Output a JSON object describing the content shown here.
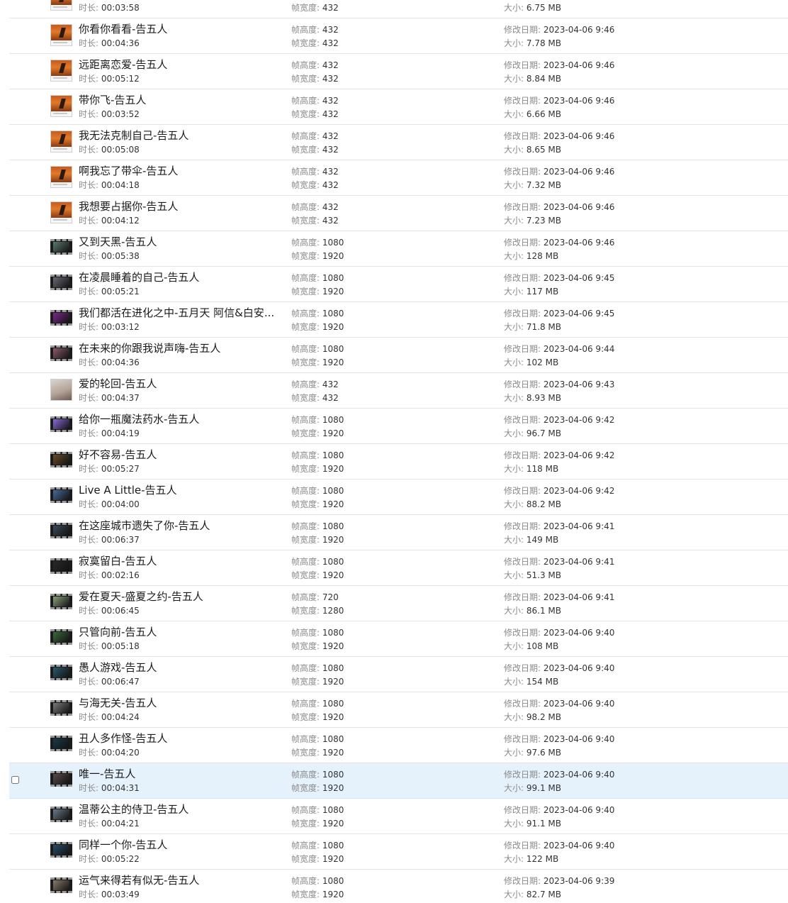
{
  "labels": {
    "duration": "时长:",
    "frame_height": "帧高度:",
    "frame_width": "帧宽度:",
    "modified": "修改日期:",
    "size": "大小:"
  },
  "items": [
    {
      "name": "",
      "duration": "00:03:58",
      "frame_height": "",
      "frame_width": "432",
      "modified": "",
      "size": "6.75 MB",
      "thumb": "music",
      "tint": "#c85a1e",
      "selected": false
    },
    {
      "name": "你看你看看-告五人",
      "duration": "00:04:36",
      "frame_height": "432",
      "frame_width": "432",
      "modified": "2023-04-06 9:46",
      "size": "7.78 MB",
      "thumb": "music",
      "tint": "#c85a1e",
      "selected": false
    },
    {
      "name": "远距离恋爱-告五人",
      "duration": "00:05:12",
      "frame_height": "432",
      "frame_width": "432",
      "modified": "2023-04-06 9:46",
      "size": "8.84 MB",
      "thumb": "music",
      "tint": "#c85a1e",
      "selected": false
    },
    {
      "name": "带你飞-告五人",
      "duration": "00:03:52",
      "frame_height": "432",
      "frame_width": "432",
      "modified": "2023-04-06 9:46",
      "size": "6.66 MB",
      "thumb": "music",
      "tint": "#c85a1e",
      "selected": false
    },
    {
      "name": "我无法克制自己-告五人",
      "duration": "00:05:08",
      "frame_height": "432",
      "frame_width": "432",
      "modified": "2023-04-06 9:46",
      "size": "8.65 MB",
      "thumb": "music",
      "tint": "#c85a1e",
      "selected": false
    },
    {
      "name": "啊我忘了带伞-告五人",
      "duration": "00:04:18",
      "frame_height": "432",
      "frame_width": "432",
      "modified": "2023-04-06 9:46",
      "size": "7.32 MB",
      "thumb": "music",
      "tint": "#c85a1e",
      "selected": false
    },
    {
      "name": "我想要占据你-告五人",
      "duration": "00:04:12",
      "frame_height": "432",
      "frame_width": "432",
      "modified": "2023-04-06 9:46",
      "size": "7.23 MB",
      "thumb": "music",
      "tint": "#c85a1e",
      "selected": false
    },
    {
      "name": "又到天黑-告五人",
      "duration": "00:05:38",
      "frame_height": "1080",
      "frame_width": "1920",
      "modified": "2023-04-06 9:46",
      "size": "128 MB",
      "thumb": "film",
      "tint": "#5a7a6e",
      "selected": false
    },
    {
      "name": "在凌晨睡着的自己-告五人",
      "duration": "00:05:21",
      "frame_height": "1080",
      "frame_width": "1920",
      "modified": "2023-04-06 9:45",
      "size": "117 MB",
      "thumb": "film",
      "tint": "#6a6a78",
      "selected": false
    },
    {
      "name": "我们都活在进化之中-五月天 阿信&白安...",
      "duration": "00:03:12",
      "frame_height": "1080",
      "frame_width": "1920",
      "modified": "2023-04-06 9:45",
      "size": "71.8 MB",
      "thumb": "film",
      "tint": "#7a2a8a",
      "selected": false
    },
    {
      "name": "在未来的你跟我说声嗨-告五人",
      "duration": "00:04:36",
      "frame_height": "1080",
      "frame_width": "1920",
      "modified": "2023-04-06 9:44",
      "size": "102 MB",
      "thumb": "film",
      "tint": "#8a5a6a",
      "selected": false
    },
    {
      "name": "爱的轮回-告五人",
      "duration": "00:04:37",
      "frame_height": "432",
      "frame_width": "432",
      "modified": "2023-04-06 9:43",
      "size": "8.93 MB",
      "thumb": "photo",
      "tint": "#b5a59a",
      "selected": false
    },
    {
      "name": "给你一瓶魔法药水-告五人",
      "duration": "00:04:19",
      "frame_height": "1080",
      "frame_width": "1920",
      "modified": "2023-04-06 9:42",
      "size": "96.7 MB",
      "thumb": "film",
      "tint": "#8a6ad8",
      "selected": false
    },
    {
      "name": "好不容易-告五人",
      "duration": "00:05:27",
      "frame_height": "1080",
      "frame_width": "1920",
      "modified": "2023-04-06 9:42",
      "size": "118 MB",
      "thumb": "film",
      "tint": "#6a4a2a",
      "selected": false
    },
    {
      "name": "Live A Little-告五人",
      "duration": "00:04:00",
      "frame_height": "1080",
      "frame_width": "1920",
      "modified": "2023-04-06 9:42",
      "size": "88.2 MB",
      "thumb": "film",
      "tint": "#4a6a9a",
      "selected": false
    },
    {
      "name": "在这座城市遗失了你-告五人",
      "duration": "00:06:37",
      "frame_height": "1080",
      "frame_width": "1920",
      "modified": "2023-04-06 9:41",
      "size": "149 MB",
      "thumb": "film",
      "tint": "#3a4a5a",
      "selected": false
    },
    {
      "name": "寂寞留白-告五人",
      "duration": "00:02:16",
      "frame_height": "1080",
      "frame_width": "1920",
      "modified": "2023-04-06 9:41",
      "size": "51.3 MB",
      "thumb": "film",
      "tint": "#2a2a2a",
      "selected": false
    },
    {
      "name": "爱在夏天-盛夏之约-告五人",
      "duration": "00:06:45",
      "frame_height": "720",
      "frame_width": "1280",
      "modified": "2023-04-06 9:41",
      "size": "86.1 MB",
      "thumb": "film",
      "tint": "#8aa07a",
      "selected": false
    },
    {
      "name": "只管向前-告五人",
      "duration": "00:05:18",
      "frame_height": "1080",
      "frame_width": "1920",
      "modified": "2023-04-06 9:40",
      "size": "108 MB",
      "thumb": "film",
      "tint": "#3a6a3a",
      "selected": false
    },
    {
      "name": "愚人游戏-告五人",
      "duration": "00:06:47",
      "frame_height": "1080",
      "frame_width": "1920",
      "modified": "2023-04-06 9:40",
      "size": "154 MB",
      "thumb": "film",
      "tint": "#2a5a6a",
      "selected": false
    },
    {
      "name": "与海无关-告五人",
      "duration": "00:04:24",
      "frame_height": "1080",
      "frame_width": "1920",
      "modified": "2023-04-06 9:40",
      "size": "98.2 MB",
      "thumb": "film",
      "tint": "#7a7a7a",
      "selected": false
    },
    {
      "name": "丑人多作怪-告五人",
      "duration": "00:04:20",
      "frame_height": "1080",
      "frame_width": "1920",
      "modified": "2023-04-06 9:40",
      "size": "97.6 MB",
      "thumb": "film",
      "tint": "#1a3a4a",
      "selected": false
    },
    {
      "name": "唯一-告五人",
      "duration": "00:04:31",
      "frame_height": "1080",
      "frame_width": "1920",
      "modified": "2023-04-06 9:40",
      "size": "99.1 MB",
      "thumb": "film",
      "tint": "#5a4a4a",
      "selected": true
    },
    {
      "name": "温蒂公主的侍卫-告五人",
      "duration": "00:04:21",
      "frame_height": "1080",
      "frame_width": "1920",
      "modified": "2023-04-06 9:40",
      "size": "91.1 MB",
      "thumb": "film",
      "tint": "#6a7a8a",
      "selected": false
    },
    {
      "name": "同样一个你-告五人",
      "duration": "00:05:22",
      "frame_height": "1080",
      "frame_width": "1920",
      "modified": "2023-04-06 9:40",
      "size": "122 MB",
      "thumb": "film",
      "tint": "#2a4a6a",
      "selected": false
    },
    {
      "name": "运气来得若有似无-告五人",
      "duration": "00:03:49",
      "frame_height": "1080",
      "frame_width": "1920",
      "modified": "2023-04-06 9:39",
      "size": "82.7 MB",
      "thumb": "film",
      "tint": "#8a7a6a",
      "selected": false
    }
  ]
}
